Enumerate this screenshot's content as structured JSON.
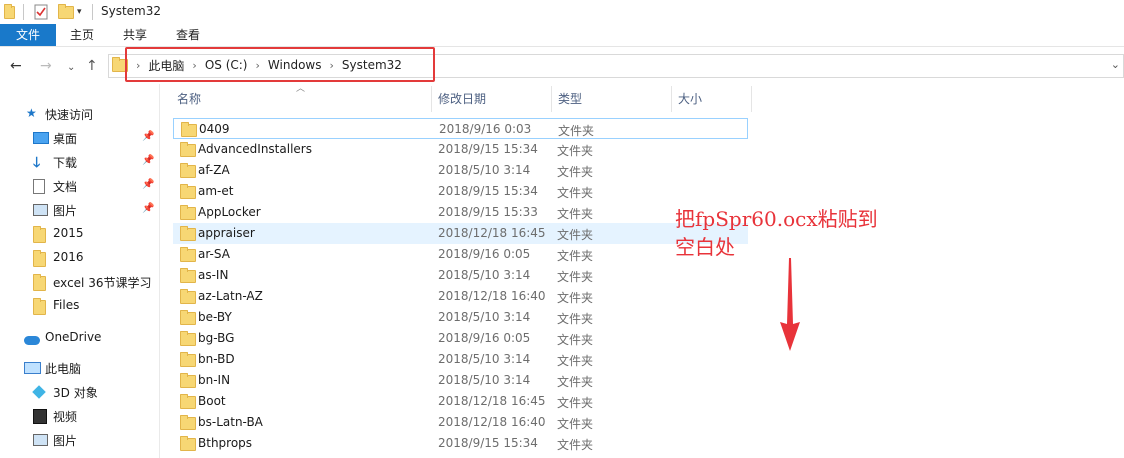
{
  "window": {
    "title": "System32"
  },
  "ribbon": {
    "tabs": [
      "文件",
      "主页",
      "共享",
      "查看"
    ]
  },
  "address": {
    "crumbs": [
      "此电脑",
      "OS (C:)",
      "Windows",
      "System32"
    ]
  },
  "sidebar": {
    "items": [
      {
        "label": "快速访问",
        "icon": "star-icon",
        "pinned": false
      },
      {
        "label": "桌面",
        "icon": "desktop-icon",
        "pinned": true
      },
      {
        "label": "下载",
        "icon": "download-icon",
        "pinned": true
      },
      {
        "label": "文档",
        "icon": "document-icon",
        "pinned": true
      },
      {
        "label": "图片",
        "icon": "picture-icon",
        "pinned": true
      },
      {
        "label": "2015",
        "icon": "folder-icon",
        "pinned": false
      },
      {
        "label": "2016",
        "icon": "folder-icon",
        "pinned": false
      },
      {
        "label": "excel 36节课学习",
        "icon": "folder-icon",
        "pinned": false
      },
      {
        "label": "Files",
        "icon": "folder-icon",
        "pinned": false
      },
      {
        "label": "OneDrive",
        "icon": "cloud-icon",
        "pinned": false
      },
      {
        "label": "此电脑",
        "icon": "pc-icon",
        "pinned": false
      },
      {
        "label": "3D 对象",
        "icon": "3d-objects-icon",
        "pinned": false
      },
      {
        "label": "视频",
        "icon": "video-icon",
        "pinned": false
      },
      {
        "label": "图片",
        "icon": "picture-icon",
        "pinned": false
      }
    ]
  },
  "columns": [
    "名称",
    "修改日期",
    "类型",
    "大小"
  ],
  "files": [
    {
      "name": "0409",
      "date": "2018/9/16 0:03",
      "type": "文件夹"
    },
    {
      "name": "AdvancedInstallers",
      "date": "2018/9/15 15:34",
      "type": "文件夹"
    },
    {
      "name": "af-ZA",
      "date": "2018/5/10 3:14",
      "type": "文件夹"
    },
    {
      "name": "am-et",
      "date": "2018/9/15 15:34",
      "type": "文件夹"
    },
    {
      "name": "AppLocker",
      "date": "2018/9/15 15:33",
      "type": "文件夹"
    },
    {
      "name": "appraiser",
      "date": "2018/12/18 16:45",
      "type": "文件夹"
    },
    {
      "name": "ar-SA",
      "date": "2018/9/16 0:05",
      "type": "文件夹"
    },
    {
      "name": "as-IN",
      "date": "2018/5/10 3:14",
      "type": "文件夹"
    },
    {
      "name": "az-Latn-AZ",
      "date": "2018/12/18 16:40",
      "type": "文件夹"
    },
    {
      "name": "be-BY",
      "date": "2018/5/10 3:14",
      "type": "文件夹"
    },
    {
      "name": "bg-BG",
      "date": "2018/9/16 0:05",
      "type": "文件夹"
    },
    {
      "name": "bn-BD",
      "date": "2018/5/10 3:14",
      "type": "文件夹"
    },
    {
      "name": "bn-IN",
      "date": "2018/5/10 3:14",
      "type": "文件夹"
    },
    {
      "name": "Boot",
      "date": "2018/12/18 16:45",
      "type": "文件夹"
    },
    {
      "name": "bs-Latn-BA",
      "date": "2018/12/18 16:40",
      "type": "文件夹"
    },
    {
      "name": "Bthprops",
      "date": "2018/9/15 15:34",
      "type": "文件夹"
    }
  ],
  "annotation": {
    "line1": "把fpSpr60.ocx粘贴到",
    "line2": "空白处"
  },
  "colors": {
    "accent": "#1979ca",
    "annotation": "#e8333a",
    "folder": "#f7d774"
  }
}
